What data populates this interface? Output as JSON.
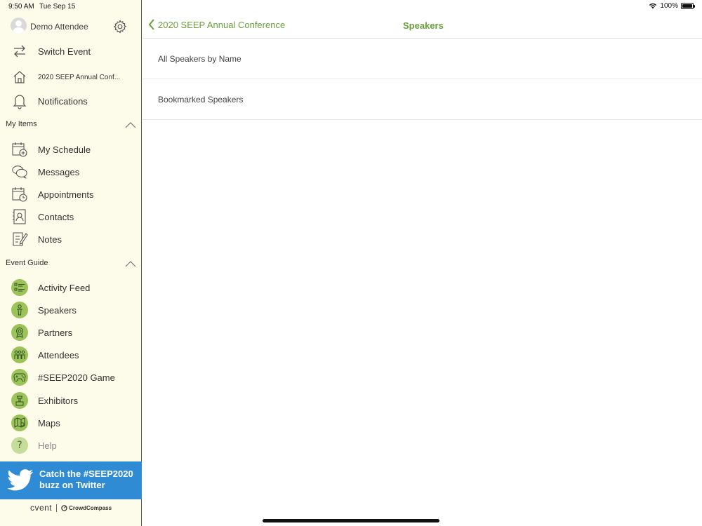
{
  "status_bar": {
    "time": "9:50 AM",
    "date": "Tue Sep 15",
    "battery": "100%"
  },
  "profile": {
    "name": "Demo Attendee"
  },
  "top_menu": [
    {
      "label": "Switch Event",
      "icon": "switch-arrows-icon"
    },
    {
      "label": "2020 SEEP Annual Conf...",
      "icon": "home-icon"
    },
    {
      "label": "Notifications",
      "icon": "bell-icon"
    }
  ],
  "my_items": {
    "title": "My Items",
    "items": [
      {
        "label": "My Schedule",
        "icon": "calendar-add-icon"
      },
      {
        "label": "Messages",
        "icon": "chat-bubbles-icon"
      },
      {
        "label": "Appointments",
        "icon": "calendar-clock-icon"
      },
      {
        "label": "Contacts",
        "icon": "contact-card-icon"
      },
      {
        "label": "Notes",
        "icon": "notepad-icon"
      }
    ]
  },
  "event_guide": {
    "title": "Event Guide",
    "items": [
      {
        "label": "Activity Feed",
        "icon": "activity-list-icon"
      },
      {
        "label": "Speakers",
        "icon": "speaker-podium-icon"
      },
      {
        "label": "Partners",
        "icon": "ribbon-award-icon"
      },
      {
        "label": "Attendees",
        "icon": "people-group-icon"
      },
      {
        "label": "#SEEP2020 Game",
        "icon": "gamepad-icon"
      },
      {
        "label": "Exhibitors",
        "icon": "booth-icon"
      },
      {
        "label": "Maps",
        "icon": "map-pin-icon"
      },
      {
        "label": "Help",
        "icon": "question-icon"
      }
    ]
  },
  "twitter_banner": {
    "line1": "Catch the #SEEP2020",
    "line2": "buzz on Twitter"
  },
  "footer": {
    "brand": "cvent",
    "partner": "CrowdCompass"
  },
  "navbar": {
    "back_label": "2020 SEEP Annual Conference",
    "title": "Speakers"
  },
  "list": [
    {
      "label": "All Speakers by Name"
    },
    {
      "label": "Bookmarked Speakers"
    }
  ],
  "colors": {
    "accent": "#6a9f3a",
    "sidebar_bg": "#fdfbea",
    "icon_green": "#9cc35a",
    "twitter_blue": "#2e8bd4"
  }
}
